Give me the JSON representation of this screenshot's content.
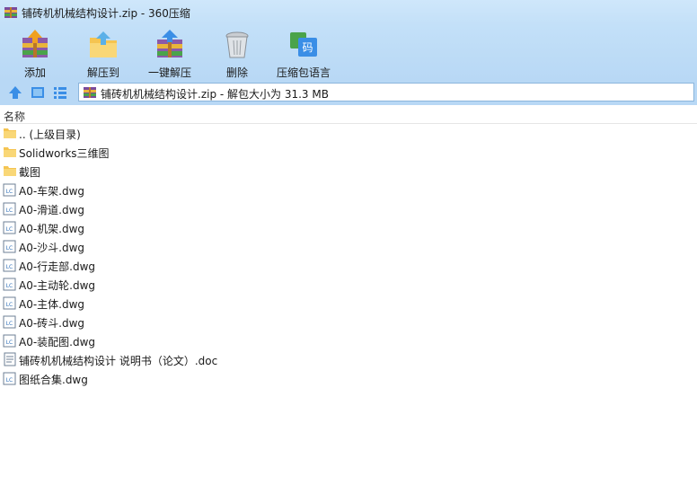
{
  "window": {
    "title": "铺砖机机械结构设计.zip - 360压缩"
  },
  "toolbar": {
    "add_label": "添加",
    "extract_label": "解压到",
    "one_click_extract_label": "一键解压",
    "delete_label": "删除",
    "zip_language_label": "压缩包语言",
    "language_glyph": "码"
  },
  "address": {
    "text": "铺砖机机械结构设计.zip - 解包大小为 31.3 MB"
  },
  "list": {
    "column_name": "名称",
    "rows": [
      {
        "name": ".. (上级目录)",
        "icon": "folder-icon"
      },
      {
        "name": "Solidworks三维图",
        "icon": "folder-icon"
      },
      {
        "name": "截图",
        "icon": "folder-icon"
      },
      {
        "name": "A0-车架.dwg",
        "icon": "dwg-file-icon"
      },
      {
        "name": "A0-滑道.dwg",
        "icon": "dwg-file-icon"
      },
      {
        "name": "A0-机架.dwg",
        "icon": "dwg-file-icon"
      },
      {
        "name": "A0-沙斗.dwg",
        "icon": "dwg-file-icon"
      },
      {
        "name": "A0-行走部.dwg",
        "icon": "dwg-file-icon"
      },
      {
        "name": "A0-主动轮.dwg",
        "icon": "dwg-file-icon"
      },
      {
        "name": "A0-主体.dwg",
        "icon": "dwg-file-icon"
      },
      {
        "name": "A0-砖斗.dwg",
        "icon": "dwg-file-icon"
      },
      {
        "name": "A0-装配图.dwg",
        "icon": "dwg-file-icon"
      },
      {
        "name": "铺砖机机械结构设计 说明书（论文）.doc",
        "icon": "doc-file-icon"
      },
      {
        "name": "图纸合集.dwg",
        "icon": "dwg-file-icon"
      }
    ]
  },
  "colors": {
    "titlebar": "#cfe7fb",
    "toolbar": "#b8d8f5",
    "folder": "#f5c451",
    "accent": "#3a8ee6"
  }
}
